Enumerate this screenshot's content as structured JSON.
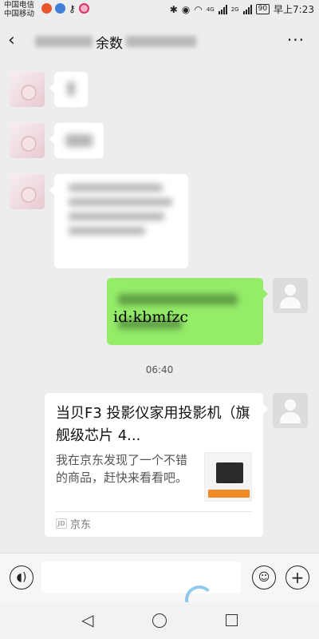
{
  "status_bar": {
    "carrier_1": "中国电信",
    "carrier_2": "中国移动",
    "network_1": "4G",
    "network_2": "2G",
    "battery": "90",
    "time": "早上7:23"
  },
  "header": {
    "title": "余数"
  },
  "messages": {
    "timestamp": "06:40",
    "overlay_text": "id:kbmfzc",
    "card": {
      "title": "当贝F3 投影仪家用投影机（旗舰级芯片 4...",
      "description": "我在京东发现了一个不错的商品，赶快来看看吧。",
      "source": "京东",
      "source_icon_text": "JD"
    }
  },
  "input_bar": {
    "message_value": ""
  }
}
